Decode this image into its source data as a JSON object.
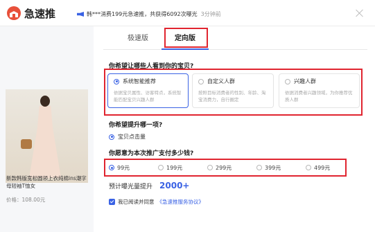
{
  "header": {
    "app_title": "急速推",
    "notice_text": "韩***消费199元急速推，共获得6092次曝光",
    "notice_time": "3分钟前"
  },
  "product": {
    "name": "新款韩版宽松圆领上衣纯棉ins潮字母短袖T恤女",
    "price": "价格：108.00元"
  },
  "tabs": [
    {
      "label": "极速版",
      "active": false
    },
    {
      "label": "定向版",
      "active": true
    }
  ],
  "audience": {
    "question": "你希望让哪些人看到你的宝贝?",
    "options": [
      {
        "title": "系统智能推荐",
        "desc": "依据宝贝属性、访客特点，系统智能匹配宝贝兴趣人群",
        "selected": true
      },
      {
        "title": "自定义人群",
        "desc": "按照目标消费者的性别、年龄、淘宝消费力，自行圈定",
        "selected": false
      },
      {
        "title": "兴趣人群",
        "desc": "依据消费者兴趣领域，为你推荐优质人群",
        "selected": false
      }
    ]
  },
  "goal": {
    "question": "你希望提升哪一项?",
    "option": "宝贝点击量"
  },
  "budget": {
    "question": "你愿意为本次推广支付多少钱?",
    "options": [
      {
        "label": "99元",
        "selected": true
      },
      {
        "label": "199元",
        "selected": false
      },
      {
        "label": "299元",
        "selected": false
      },
      {
        "label": "399元",
        "selected": false
      },
      {
        "label": "499元",
        "selected": false
      }
    ]
  },
  "exposure": {
    "label": "预计曝光量提升",
    "value": "2000+"
  },
  "agreement": {
    "text": "我已阅读并同意",
    "link": "《急速推服务协议》",
    "checked": true
  },
  "colors": {
    "accent": "#3a62e4",
    "highlight_box": "#e0242f",
    "logo": "#e8503a"
  }
}
